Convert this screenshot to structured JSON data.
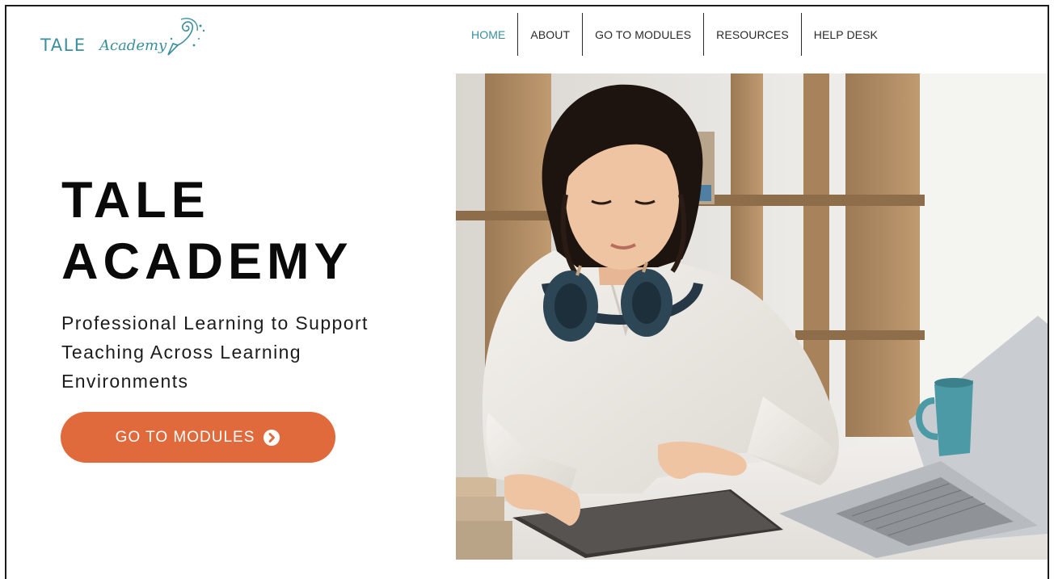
{
  "logo": {
    "word1": "TALE",
    "word2": "Academy",
    "icon": "pencil-swirl-icon"
  },
  "nav": {
    "items": [
      {
        "label": "HOME",
        "active": true
      },
      {
        "label": "ABOUT",
        "active": false
      },
      {
        "label": "GO TO MODULES",
        "active": false
      },
      {
        "label": "RESOURCES",
        "active": false
      },
      {
        "label": "HELP DESK",
        "active": false
      }
    ]
  },
  "hero": {
    "title_line1": "TALE",
    "title_line2": "ACADEMY",
    "subtitle_line1": "Professional Learning to Support",
    "subtitle_line2": "Teaching Across Learning",
    "subtitle_line3": "Environments",
    "cta_label": "GO TO MODULES",
    "cta_icon": "chevron-circle-right-icon",
    "image": "woman-with-headphones-using-tablet-photo"
  },
  "colors": {
    "brand_teal": "#3a8f9b",
    "accent_orange": "#e06a3b",
    "text_dark": "#0a0a0a"
  }
}
